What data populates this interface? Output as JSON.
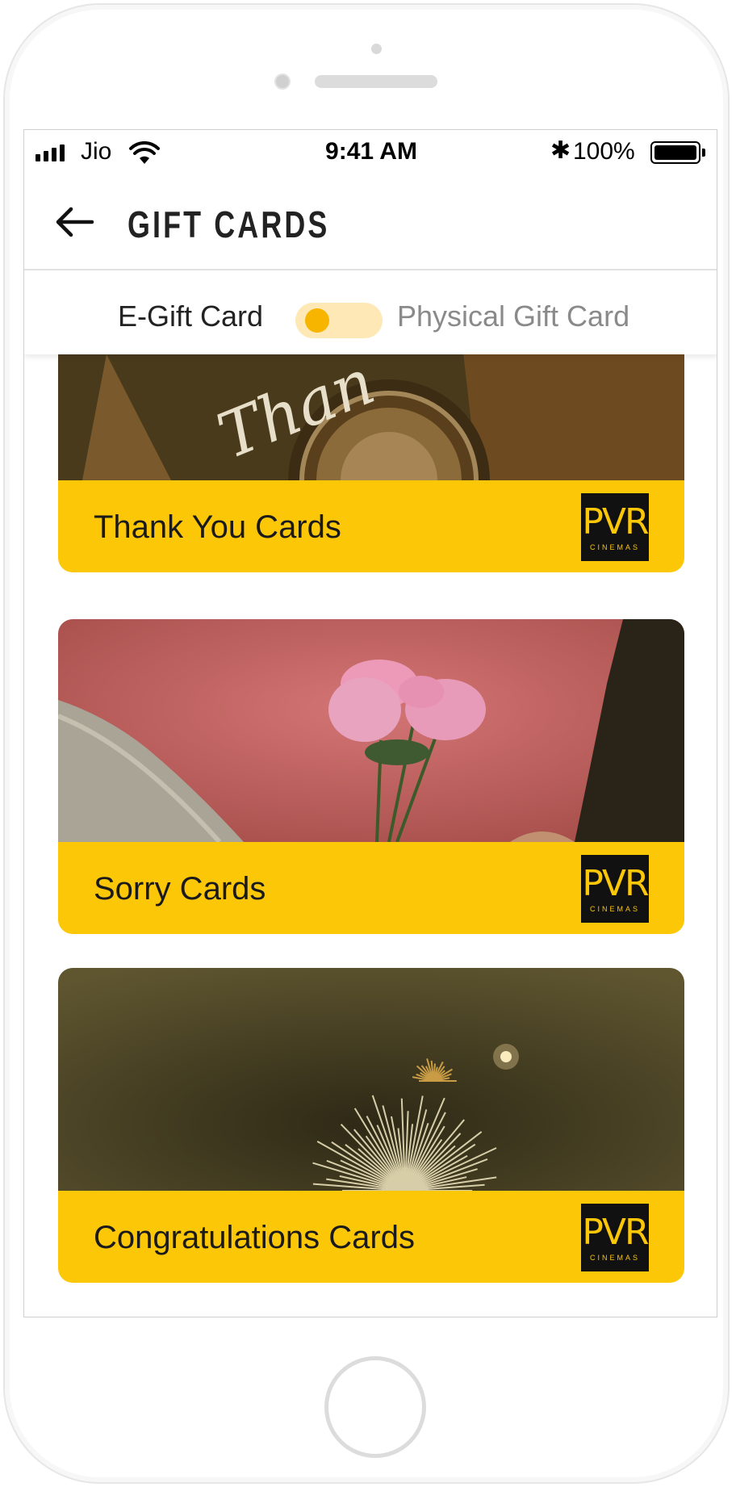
{
  "status_bar": {
    "carrier": "Jio",
    "time": "9:41 AM",
    "bluetooth": "✱",
    "battery_percent": "100%",
    "battery_level": 1.0
  },
  "header": {
    "back_icon": "arrow-left-icon",
    "title": "GIFT CARDS"
  },
  "toggle": {
    "left_label": "E-Gift Card",
    "right_label": "Physical Gift Card",
    "selected": "E-Gift Card"
  },
  "cards": [
    {
      "label": "Thank You Cards",
      "image_text": "Than",
      "logo": "PVR",
      "logo_sub": "CINEMAS"
    },
    {
      "label": "Sorry Cards",
      "logo": "PVR",
      "logo_sub": "CINEMAS"
    },
    {
      "label": "Congratulations Cards",
      "logo": "PVR",
      "logo_sub": "CINEMAS"
    }
  ],
  "colors": {
    "accent_yellow": "#fbc707",
    "toggle_track": "#fde8b6",
    "toggle_knob": "#f7b500",
    "logo_bg": "#111111"
  }
}
